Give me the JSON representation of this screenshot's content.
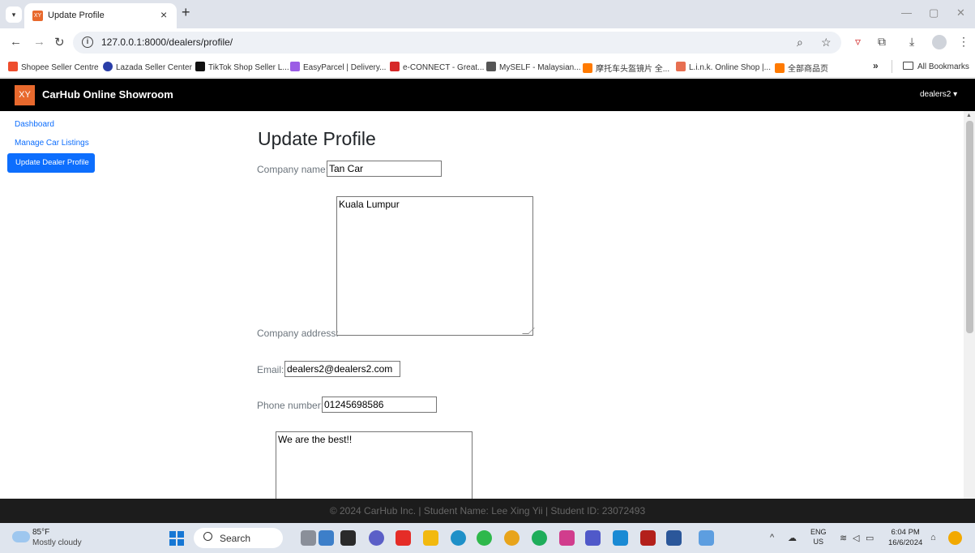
{
  "browser": {
    "tab_title": "Update Profile",
    "tab_favicon": "XY",
    "new_tab": "+",
    "close": "×",
    "url": "127.0.0.1:8000/dealers/profile/",
    "bookmarks": [
      {
        "label": "Shopee Seller Centre",
        "color": "#ee4d2d"
      },
      {
        "label": "Lazada Seller Center",
        "color": "#2a3ea8"
      },
      {
        "label": "TikTok Shop Seller L...",
        "color": "#111111"
      },
      {
        "label": "EasyParcel | Delivery...",
        "color": "#9b5de5"
      },
      {
        "label": "e-CONNECT - Great...",
        "color": "#d62828"
      },
      {
        "label": "MySELF - Malaysian...",
        "color": "#555555"
      },
      {
        "label": "摩托车头盔镜片 全...",
        "color": "#ff7a00"
      },
      {
        "label": "L.i.n.k. Online Shop |...",
        "color": "#e76f51"
      },
      {
        "label": "全部商品页",
        "color": "#ff7a00"
      }
    ],
    "bookmarks_more": "»",
    "all_bookmarks": "All Bookmarks"
  },
  "site": {
    "logo": "XY",
    "brand": "CarHub Online Showroom",
    "user": "dealers2 ▾",
    "footer": "© 2024 CarHub Inc. | Student Name: Lee Xing Yii | Student ID: 23072493"
  },
  "sidebar": {
    "items": [
      {
        "label": "Dashboard"
      },
      {
        "label": "Manage Car Listings"
      },
      {
        "label": "Update Dealer Profile"
      }
    ]
  },
  "form": {
    "heading": "Update Profile",
    "company_name_label": "Company name:",
    "company_name": "Tan Car",
    "company_address_label": "Company address:",
    "company_address": "Kuala Lumpur",
    "email_label": "Email:",
    "email": "dealers2@dealers2.com",
    "phone_label": "Phone number:",
    "phone": "01245698586",
    "description": "We are the best!!"
  },
  "taskbar": {
    "temperature": "85°F",
    "weather": "Mostly cloudy",
    "search": "Search",
    "lang_1": "ENG",
    "lang_2": "US",
    "time": "6:04 PM",
    "date": "16/6/2024"
  },
  "colors": {
    "accent": "#0d6efd",
    "brand_logo": "#e8692d",
    "navbar": "#000000"
  }
}
